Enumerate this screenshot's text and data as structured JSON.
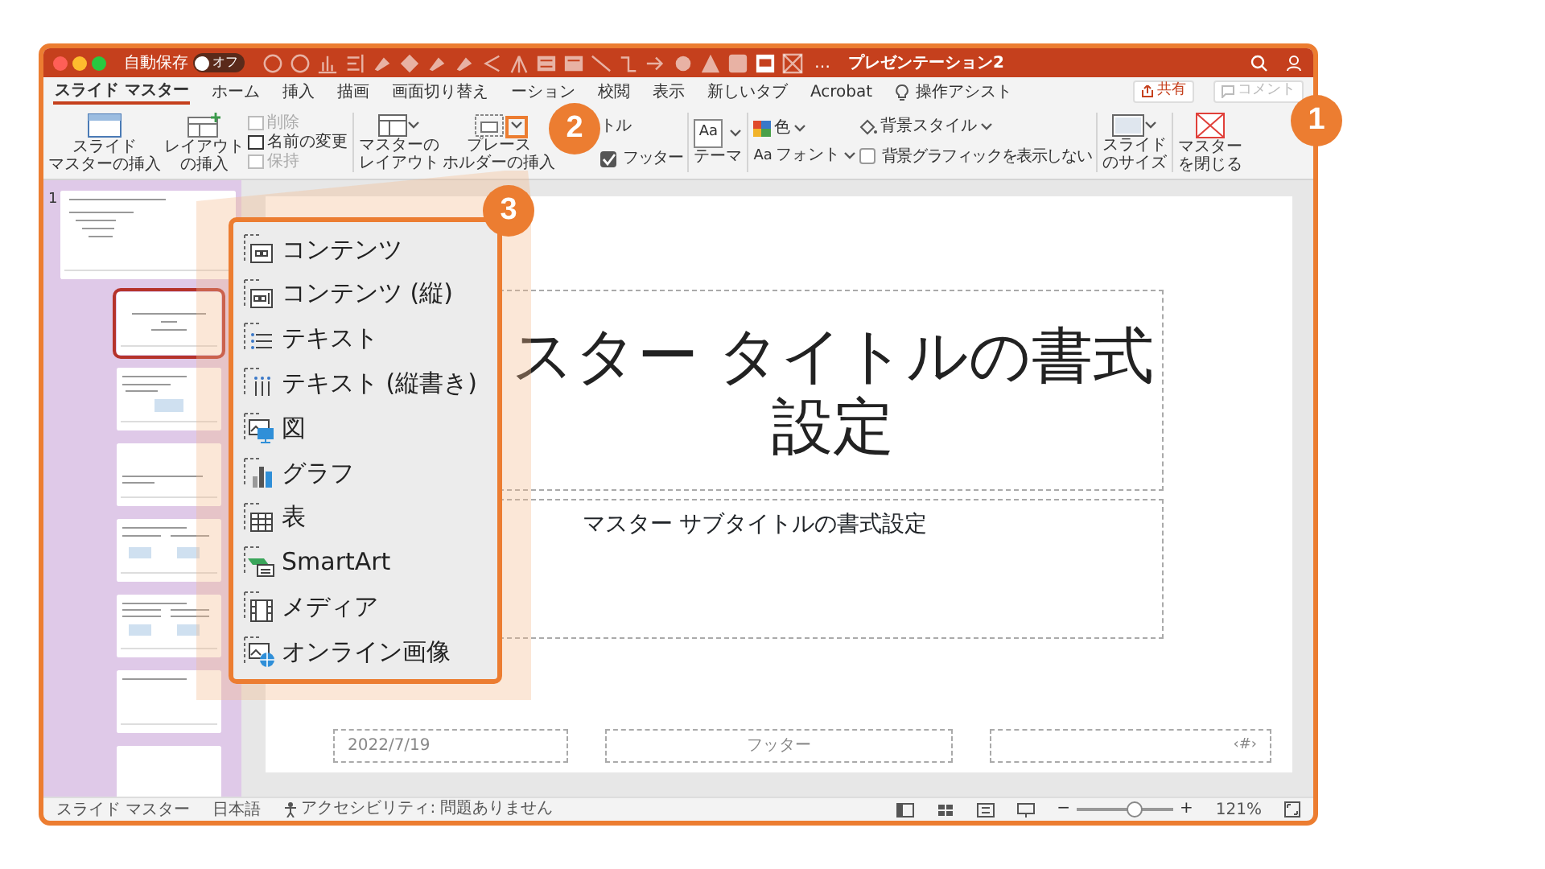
{
  "title_bar": {
    "autosave_label": "自動保存",
    "autosave_toggle": {
      "label": "オフ",
      "on": false
    },
    "more": "…",
    "document_title": "プレゼンテーション2"
  },
  "tabs": [
    {
      "label": "スライド マスター",
      "selected": true
    },
    {
      "label": "ホーム",
      "selected": false
    },
    {
      "label": "挿入",
      "selected": false
    },
    {
      "label": "描画",
      "selected": false
    },
    {
      "label": "画面切り替え",
      "selected": false
    },
    {
      "label": "ーション",
      "selected": false
    },
    {
      "label": "校閲",
      "selected": false
    },
    {
      "label": "表示",
      "selected": false
    },
    {
      "label": "新しいタブ",
      "selected": false
    },
    {
      "label": "Acrobat",
      "selected": false
    }
  ],
  "assist": "操作アシスト",
  "share_button": "共有",
  "comment_button": {
    "label": "コメント",
    "disabled": true
  },
  "ribbon": {
    "insert_master": [
      "スライド",
      "マスターの挿入"
    ],
    "insert_layout": [
      "レイアウト",
      "の挿入"
    ],
    "small_buttons": [
      {
        "label": "削除",
        "disabled": true
      },
      {
        "label": "名前の変更",
        "disabled": false
      },
      {
        "label": "保持",
        "disabled": true
      }
    ],
    "master_layout": [
      "マスターの",
      "レイアウト"
    ],
    "insert_placeholder": [
      "プレース",
      "ホルダーの挿入"
    ],
    "title_option": "トル",
    "footer_option": {
      "label": "フッター",
      "checked": true
    },
    "theme_icon_text": "Aa",
    "theme": "テーマ",
    "colors": "色",
    "fonts_icon_text": "Aa",
    "fonts": "フォント",
    "background_styles": "背景スタイル",
    "hide_background": {
      "label": "背景グラフィックを表示しない",
      "checked": false
    },
    "slide_size": [
      "スライド",
      "のサイズ"
    ],
    "close_master": [
      "マスター",
      "を閉じる"
    ]
  },
  "thumbnails": [
    {
      "kind": "master",
      "number": "1",
      "selected": false
    },
    {
      "kind": "title",
      "selected": true
    },
    {
      "kind": "content",
      "selected": false
    },
    {
      "kind": "section",
      "selected": false
    },
    {
      "kind": "two-content",
      "selected": false
    },
    {
      "kind": "comparison",
      "selected": false
    },
    {
      "kind": "title-only",
      "selected": false
    },
    {
      "kind": "blank",
      "selected": false
    }
  ],
  "slide": {
    "title": "スター タイトルの書式設定",
    "subtitle": "マスター サブタイトルの書式設定",
    "date": "2022/7/19",
    "footer": "フッター",
    "number": "‹#›"
  },
  "placeholder_menu": [
    {
      "kind": "content",
      "label": "コンテンツ"
    },
    {
      "kind": "content-vertical",
      "label": "コンテンツ (縦)"
    },
    {
      "kind": "text",
      "label": "テキスト"
    },
    {
      "kind": "text-vertical",
      "label": "テキスト (縦書き)"
    },
    {
      "kind": "picture",
      "label": "図"
    },
    {
      "kind": "chart",
      "label": "グラフ"
    },
    {
      "kind": "table",
      "label": "表"
    },
    {
      "kind": "smartart",
      "label": "SmartArt"
    },
    {
      "kind": "media",
      "label": "メディア"
    },
    {
      "kind": "online-picture",
      "label": "オンライン画像"
    }
  ],
  "callouts": [
    "1",
    "2",
    "3"
  ],
  "status_bar": {
    "view": "スライド マスター",
    "language": "日本語",
    "accessibility": "アクセシビリティ: 問題ありません",
    "zoom_out": "−",
    "zoom": {
      "level": 0.6
    },
    "zoom_in": "+",
    "zoom_reading": "121%"
  }
}
